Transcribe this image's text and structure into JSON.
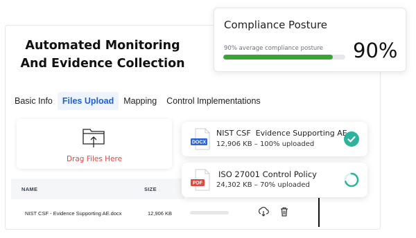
{
  "hero": {
    "line1": "Automated Monitoring",
    "line2": "And Evidence Collection"
  },
  "tabs": [
    {
      "label": "Basic Info",
      "active": false
    },
    {
      "label": "Files Upload",
      "active": true
    },
    {
      "label": "Mapping",
      "active": false
    },
    {
      "label": "Control Implementations",
      "active": false
    }
  ],
  "dropzone": {
    "label": "Drag Files Here",
    "icon": "folder-upload-icon"
  },
  "table": {
    "headers": {
      "name": "NAME",
      "size": "SIZE"
    },
    "rows": [
      {
        "name": "NIST CSF - Evidence Supporting AE.docx",
        "size": "12,906 KB",
        "actions": [
          "download-icon",
          "trash-icon"
        ]
      }
    ]
  },
  "uploads": [
    {
      "type_badge": "DOCX",
      "title": "NIST CSF  Evidence Supporting AE",
      "subtitle": "12,906 KB – 100% uploaded",
      "progress": 1.0,
      "status": "complete",
      "badge_color": "#2f64d6"
    },
    {
      "type_badge": "PDF",
      "title": "ISO 27001 Control Policy",
      "subtitle": "24,302 KB – 70% uploaded",
      "progress": 0.7,
      "status": "uploading",
      "badge_color": "#e0483c"
    }
  ],
  "posture": {
    "title": "Compliance Posture",
    "subtitle": "90% average compliance posture",
    "value_label": "90%",
    "fraction": 0.9,
    "bar_color": "#3aa536"
  },
  "colors": {
    "accent": "#1d5fd8",
    "success": "#2bb39b",
    "danger": "#e0483c"
  }
}
